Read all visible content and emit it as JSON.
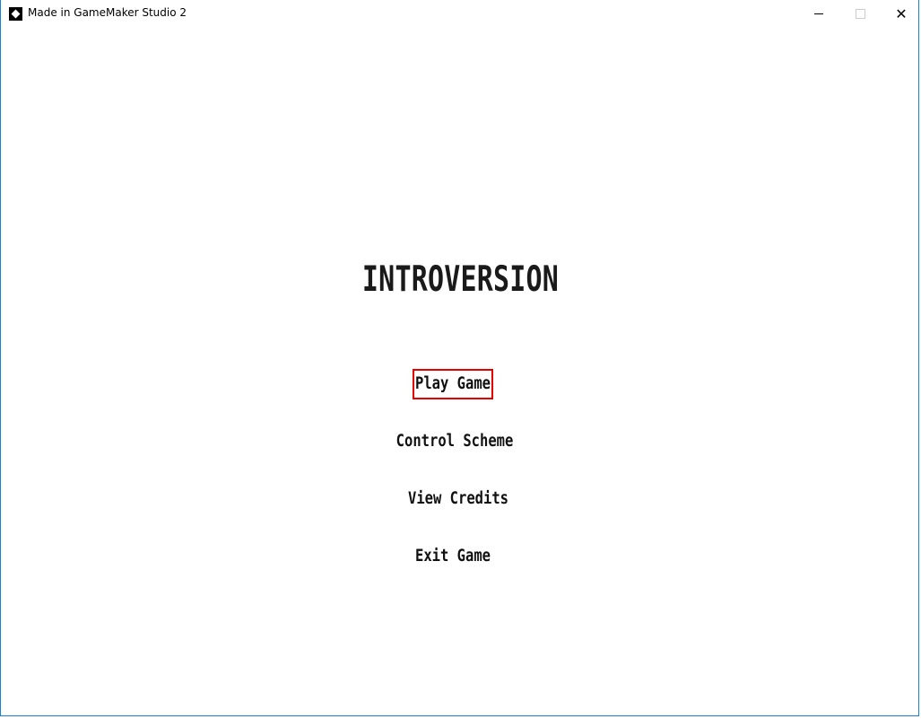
{
  "window": {
    "title": "Made in GameMaker Studio 2",
    "controls": {
      "minimize": "minimize",
      "maximize": "maximize",
      "close": "✕"
    }
  },
  "game": {
    "title": "INTROVERSION",
    "menu": [
      {
        "label": "Play Game",
        "selected": true
      },
      {
        "label": "Control Scheme",
        "selected": false
      },
      {
        "label": "View Credits",
        "selected": false
      },
      {
        "label": "Exit Game",
        "selected": false
      }
    ],
    "selection_color": "#e60000"
  }
}
